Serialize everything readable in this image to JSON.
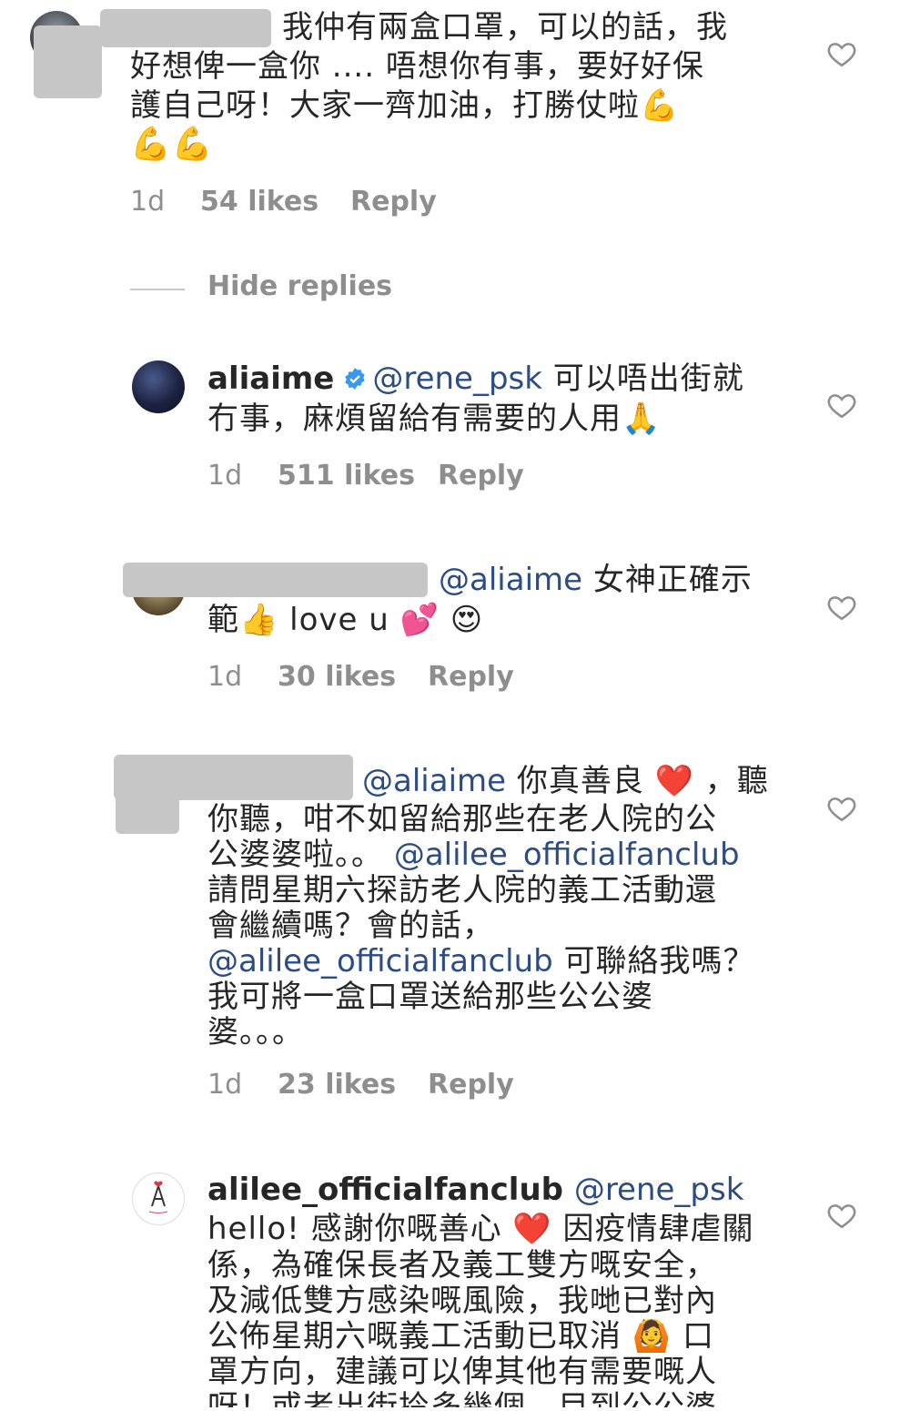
{
  "comments": [
    {
      "lines": [
        "我仲有兩盒口罩，可以的話，我",
        "好想俾一盒你 .... 唔想你有事，要好好保",
        "護自己呀！大家一齊加油，打勝仗啦💪",
        "💪💪"
      ],
      "age": "1d",
      "likes": "54 likes",
      "reply": "Reply"
    },
    {
      "username": "aliaime",
      "mention": "@rene_psk",
      "lines": [
        "可以唔出街就",
        "冇事，麻煩留給有需要的人用🙏"
      ],
      "age": "1d",
      "likes": "511 likes",
      "reply": "Reply"
    },
    {
      "mention": "@aliaime",
      "lines": [
        "女神正確示",
        "範👍 love u 💕 😍"
      ],
      "age": "1d",
      "likes": "30 likes",
      "reply": "Reply"
    },
    {
      "mention": "@aliaime",
      "mention2": "@alilee_officialfanclub",
      "lines": [
        "你真善良 ❤️ ，聽",
        "你聽，咁不如留給那些在老人院的公",
        "公婆婆啦。。",
        "請問星期六探訪老人院的義工活動還",
        "會繼續嗎？會的話，",
        "可聯絡我嗎？",
        "我可將一盒口罩送給那些公公婆",
        "婆。。。"
      ],
      "age": "1d",
      "likes": "23 likes",
      "reply": "Reply"
    },
    {
      "username": "alilee_officialfanclub",
      "mention": "@rene_psk",
      "lines": [
        "hello! 感謝你嘅善心 ❤️ 因疫情肆虐關",
        "係，為確保長者及義工雙方嘅安全，",
        "及減低雙方感染嘅風險，我哋已對內",
        "公佈星期六嘅義工活動已取消 🙆 口",
        "罩方向，建議可以俾其他有需要嘅人",
        "呀！或者出街拎多幾個，目到公公婆"
      ]
    }
  ],
  "hide_replies": "Hide replies",
  "colors": {
    "mention": "#2b4c85",
    "meta": "#8e8e8e",
    "verified": "#3897f0"
  }
}
